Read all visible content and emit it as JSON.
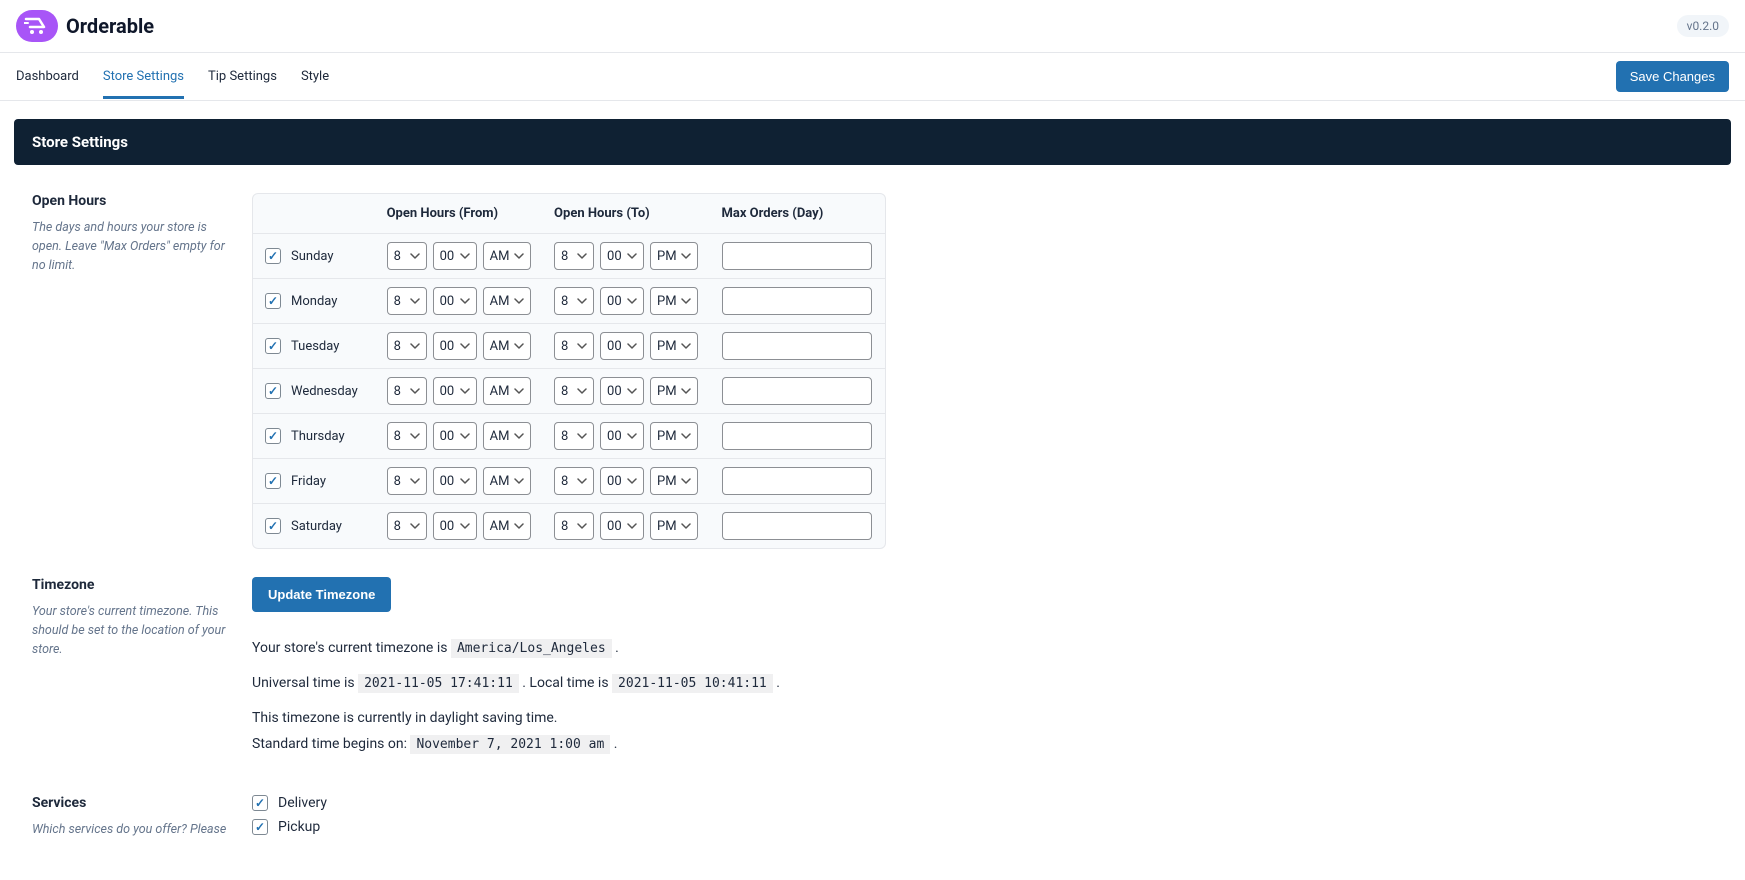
{
  "brand": {
    "name": "Orderable"
  },
  "version": "v0.2.0",
  "nav": {
    "tabs": [
      {
        "label": "Dashboard",
        "active": false
      },
      {
        "label": "Store Settings",
        "active": true
      },
      {
        "label": "Tip Settings",
        "active": false
      },
      {
        "label": "Style",
        "active": false
      }
    ],
    "save_label": "Save Changes"
  },
  "page_title": "Store Settings",
  "open_hours": {
    "title": "Open Hours",
    "help": "The days and hours your store is open. Leave \"Max Orders\" empty for no limit.",
    "headers": {
      "from": "Open Hours (From)",
      "to": "Open Hours (To)",
      "max": "Max Orders (Day)"
    },
    "rows": [
      {
        "day": "Sunday",
        "enabled": true,
        "from_h": "8",
        "from_m": "00",
        "from_ap": "AM",
        "to_h": "8",
        "to_m": "00",
        "to_ap": "PM",
        "max": ""
      },
      {
        "day": "Monday",
        "enabled": true,
        "from_h": "8",
        "from_m": "00",
        "from_ap": "AM",
        "to_h": "8",
        "to_m": "00",
        "to_ap": "PM",
        "max": ""
      },
      {
        "day": "Tuesday",
        "enabled": true,
        "from_h": "8",
        "from_m": "00",
        "from_ap": "AM",
        "to_h": "8",
        "to_m": "00",
        "to_ap": "PM",
        "max": ""
      },
      {
        "day": "Wednesday",
        "enabled": true,
        "from_h": "8",
        "from_m": "00",
        "from_ap": "AM",
        "to_h": "8",
        "to_m": "00",
        "to_ap": "PM",
        "max": ""
      },
      {
        "day": "Thursday",
        "enabled": true,
        "from_h": "8",
        "from_m": "00",
        "from_ap": "AM",
        "to_h": "8",
        "to_m": "00",
        "to_ap": "PM",
        "max": ""
      },
      {
        "day": "Friday",
        "enabled": true,
        "from_h": "8",
        "from_m": "00",
        "from_ap": "AM",
        "to_h": "8",
        "to_m": "00",
        "to_ap": "PM",
        "max": ""
      },
      {
        "day": "Saturday",
        "enabled": true,
        "from_h": "8",
        "from_m": "00",
        "from_ap": "AM",
        "to_h": "8",
        "to_m": "00",
        "to_ap": "PM",
        "max": ""
      }
    ]
  },
  "timezone": {
    "title": "Timezone",
    "help": "Your store's current timezone. This should be set to the location of your store.",
    "button": "Update Timezone",
    "current_prefix": "Your store's current timezone is ",
    "current_value": "America/Los_Angeles",
    "utc_prefix": "Universal time is ",
    "utc_value": "2021-11-05 17:41:11",
    "local_prefix": ". Local time is ",
    "local_value": "2021-11-05 10:41:11",
    "dst_line": "This timezone is currently in daylight saving time.",
    "std_prefix": "Standard time begins on: ",
    "std_value": "November 7, 2021 1:00 am",
    "period": "."
  },
  "services": {
    "title": "Services",
    "help": "Which services do you offer? Please",
    "options": [
      {
        "label": "Delivery",
        "checked": true
      },
      {
        "label": "Pickup",
        "checked": true
      }
    ]
  }
}
